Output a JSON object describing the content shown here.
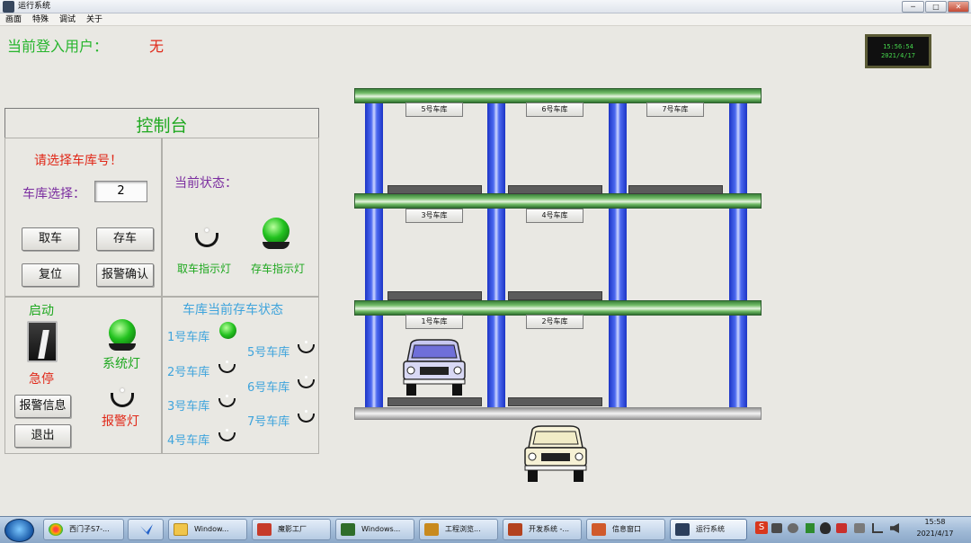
{
  "window": {
    "title": "运行系统",
    "minimize": "─",
    "maximize": "□",
    "close": "✕"
  },
  "menu": [
    "画面",
    "特殊",
    "调试",
    "关于"
  ],
  "user": {
    "label": "当前登入用户：",
    "value": "无"
  },
  "clock": {
    "time": "15:56:54",
    "date": "2021/4/17"
  },
  "console": {
    "title": "控制台",
    "select_prompt": "请选择车库号！",
    "select_label": "车库选择：",
    "select_value": "2",
    "buttons": {
      "take": "取车",
      "store": "存车",
      "reset": "复位",
      "alarm_confirm": "报警确认"
    },
    "status_title": "当前状态：",
    "indicators": {
      "take_lamp": "取车指示灯",
      "store_lamp": "存车指示灯"
    },
    "start": "启动",
    "estop": "急停",
    "system_lamp": "系统灯",
    "alarm_lamp": "报警灯",
    "alarm_info": "报警信息",
    "exit": "退出",
    "garage_status_title": "车库当前存车状态",
    "garages": [
      {
        "label": "1号车库",
        "occupied": true
      },
      {
        "label": "2号车库",
        "occupied": false
      },
      {
        "label": "3号车库",
        "occupied": false
      },
      {
        "label": "4号车库",
        "occupied": false
      },
      {
        "label": "5号车库",
        "occupied": false
      },
      {
        "label": "6号车库",
        "occupied": false
      },
      {
        "label": "7号车库",
        "occupied": false
      }
    ]
  },
  "slots": {
    "s1": "1号车库",
    "s2": "2号车库",
    "s3": "3号车库",
    "s4": "4号车库",
    "s5": "5号车库",
    "s6": "6号车库",
    "s7": "7号车库"
  },
  "taskbar": {
    "items": [
      "西门子S7-...",
      "",
      "Window...",
      "魔影工厂",
      "Windows...",
      "工程浏览...",
      "开发系统 -...",
      "信息窗口",
      "运行系统"
    ],
    "time": "15:58",
    "date": "2021/4/17"
  },
  "colors": {
    "accent_green": "#27b52d",
    "alert_red": "#e02818",
    "label_blue": "#3fa4dc",
    "post_blue": "#1c35c6"
  }
}
